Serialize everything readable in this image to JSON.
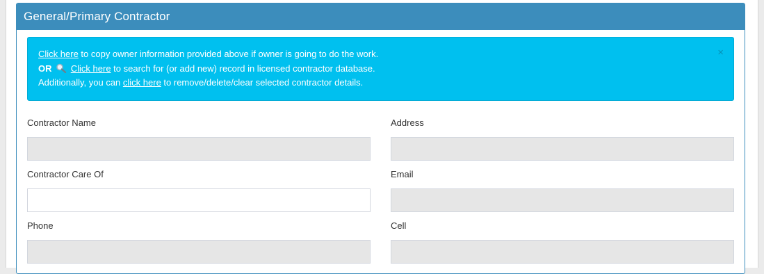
{
  "panel": {
    "title": "General/Primary Contractor"
  },
  "alert": {
    "line1_link": "Click here",
    "line1_text": " to copy owner information provided above if owner is going to do the work.",
    "line2_prefix": "OR",
    "line2_link": "Click here",
    "line2_text": " to search for (or add new) record in licensed contractor database.",
    "line3_prefix": "Additionally, you can ",
    "line3_link": "click here",
    "line3_text": " to remove/delete/clear selected contractor details.",
    "close_glyph": "×"
  },
  "fields": {
    "contractor_name": {
      "label": "Contractor Name",
      "value": ""
    },
    "address": {
      "label": "Address",
      "value": ""
    },
    "contractor_care_of": {
      "label": "Contractor Care Of",
      "value": ""
    },
    "email": {
      "label": "Email",
      "value": ""
    },
    "phone": {
      "label": "Phone",
      "value": ""
    },
    "cell": {
      "label": "Cell",
      "value": ""
    }
  },
  "colors": {
    "panel_header": "#3c8dbc",
    "alert_bg": "#00c0ef",
    "disabled_input": "#e6e6e6"
  }
}
